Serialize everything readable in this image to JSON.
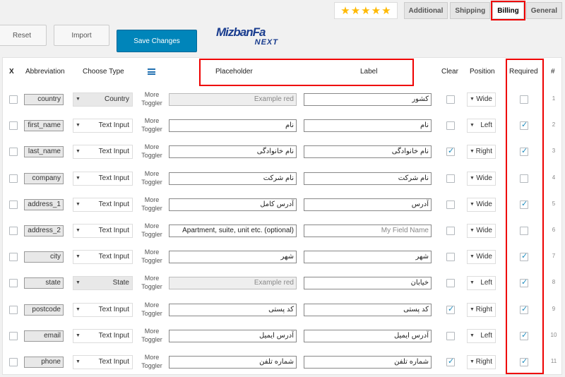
{
  "tabs": [
    {
      "label": "Additional",
      "active": false
    },
    {
      "label": "Shipping",
      "active": false
    },
    {
      "label": "Billing",
      "active": true
    },
    {
      "label": "General",
      "active": false
    }
  ],
  "rating": {
    "stars": 5,
    "icon": "star-icon",
    "color": "#ffb900"
  },
  "toolbar": {
    "reset_label": "Reset",
    "import_label": "Import",
    "save_label": "Save Changes"
  },
  "logo": {
    "line1": "MizbanFa",
    "line2": "NEXT"
  },
  "columns": {
    "x": "X",
    "abbreviation": "Abbreviation",
    "choose_type": "Choose Type",
    "placeholder": "Placeholder",
    "label": "Label",
    "clear": "Clear",
    "position": "Position",
    "required": "Required",
    "number": "#"
  },
  "more_toggler": {
    "line1": "More",
    "line2": "Toggler"
  },
  "rows": [
    {
      "abbr": "country",
      "type": "Country",
      "type_disabled": true,
      "placeholder": "Example red",
      "placeholder_disabled": true,
      "label": "کشور",
      "label_is_placeholder": false,
      "clear": false,
      "position": "Wide",
      "required": false,
      "num": "1"
    },
    {
      "abbr": "first_name",
      "type": "Text Input",
      "type_disabled": false,
      "placeholder": "نام",
      "placeholder_disabled": false,
      "label": "نام",
      "label_is_placeholder": false,
      "clear": false,
      "position": "Left",
      "required": true,
      "num": "2"
    },
    {
      "abbr": "last_name",
      "type": "Text Input",
      "type_disabled": false,
      "placeholder": "نام خانوادگی",
      "placeholder_disabled": false,
      "label": "نام خانوادگی",
      "label_is_placeholder": false,
      "clear": true,
      "position": "Right",
      "required": true,
      "num": "3"
    },
    {
      "abbr": "company",
      "type": "Text Input",
      "type_disabled": false,
      "placeholder": "نام شرکت",
      "placeholder_disabled": false,
      "label": "نام شرکت",
      "label_is_placeholder": false,
      "clear": false,
      "position": "Wide",
      "required": false,
      "num": "4"
    },
    {
      "abbr": "address_1",
      "type": "Text Input",
      "type_disabled": false,
      "placeholder": "آدرس کامل",
      "placeholder_disabled": false,
      "label": "آدرس",
      "label_is_placeholder": false,
      "clear": false,
      "position": "Wide",
      "required": true,
      "num": "5"
    },
    {
      "abbr": "address_2",
      "type": "Text Input",
      "type_disabled": false,
      "placeholder": "Apartment, suite, unit etc. (optional)",
      "placeholder_disabled": false,
      "label": "My Field Name",
      "label_is_placeholder": true,
      "clear": false,
      "position": "Wide",
      "required": false,
      "num": "6"
    },
    {
      "abbr": "city",
      "type": "Text Input",
      "type_disabled": false,
      "placeholder": "شهر",
      "placeholder_disabled": false,
      "label": "شهر",
      "label_is_placeholder": false,
      "clear": false,
      "position": "Wide",
      "required": true,
      "num": "7"
    },
    {
      "abbr": "state",
      "type": "State",
      "type_disabled": true,
      "placeholder": "Example red",
      "placeholder_disabled": true,
      "label": "خیابان",
      "label_is_placeholder": false,
      "clear": false,
      "position": "Left",
      "required": true,
      "num": "8"
    },
    {
      "abbr": "postcode",
      "type": "Text Input",
      "type_disabled": false,
      "placeholder": "کد پستی",
      "placeholder_disabled": false,
      "label": "کد پستی",
      "label_is_placeholder": false,
      "clear": true,
      "position": "Right",
      "required": true,
      "num": "9"
    },
    {
      "abbr": "email",
      "type": "Text Input",
      "type_disabled": false,
      "placeholder": "آدرس ایمیل",
      "placeholder_disabled": false,
      "label": "آدرس ایمیل",
      "label_is_placeholder": false,
      "clear": false,
      "position": "Left",
      "required": true,
      "num": "10"
    },
    {
      "abbr": "phone",
      "type": "Text Input",
      "type_disabled": false,
      "placeholder": "شماره تلفن",
      "placeholder_disabled": false,
      "label": "شماره تلفن",
      "label_is_placeholder": false,
      "clear": true,
      "position": "Right",
      "required": true,
      "num": "11"
    }
  ],
  "colors": {
    "accent": "#0085ba",
    "highlight": "#e00000",
    "check": "#1e8cbe"
  }
}
